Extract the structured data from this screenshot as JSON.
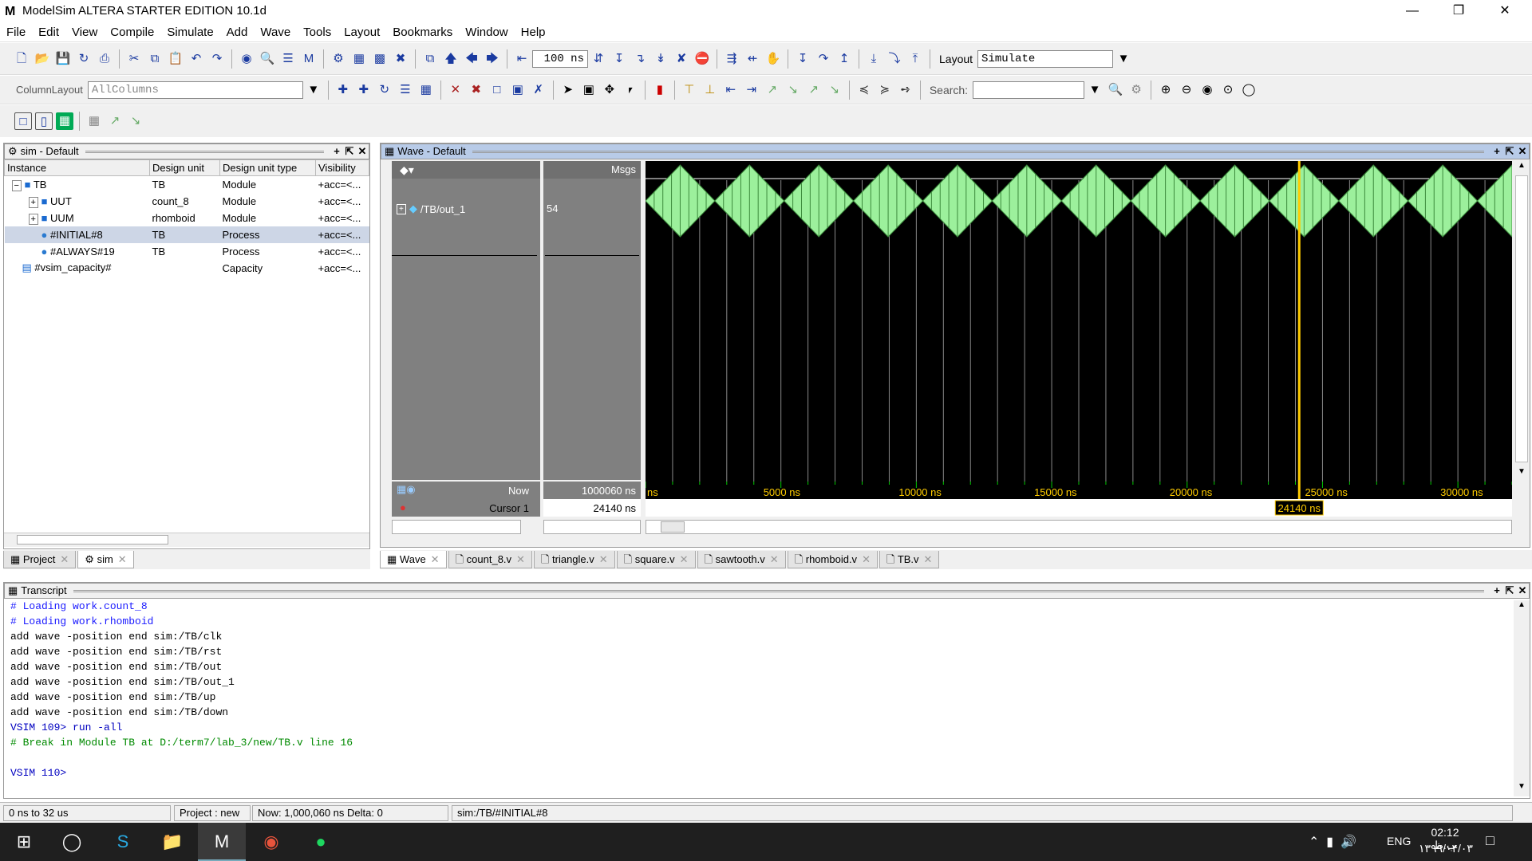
{
  "window": {
    "title": "ModelSim ALTERA STARTER EDITION 10.1d",
    "logo": "M"
  },
  "menu": [
    "File",
    "Edit",
    "View",
    "Compile",
    "Simulate",
    "Add",
    "Wave",
    "Tools",
    "Layout",
    "Bookmarks",
    "Window",
    "Help"
  ],
  "toolbar": {
    "run_length": "100 ns",
    "layout_label": "Layout",
    "layout_value": "Simulate",
    "column_layout_label": "ColumnLayout",
    "column_layout_value": "AllColumns",
    "search_label": "Search:"
  },
  "sim_panel": {
    "title": "sim - Default",
    "columns": [
      "Instance",
      "Design unit",
      "Design unit type",
      "Visibility"
    ],
    "rows": [
      {
        "instance": "TB",
        "unit": "TB",
        "type": "Module",
        "vis": "+acc=<..."
      },
      {
        "instance": "UUT",
        "unit": "count_8",
        "type": "Module",
        "vis": "+acc=<..."
      },
      {
        "instance": "UUM",
        "unit": "rhomboid",
        "type": "Module",
        "vis": "+acc=<..."
      },
      {
        "instance": "#INITIAL#8",
        "unit": "TB",
        "type": "Process",
        "vis": "+acc=<..."
      },
      {
        "instance": "#ALWAYS#19",
        "unit": "TB",
        "type": "Process",
        "vis": "+acc=<..."
      },
      {
        "instance": "#vsim_capacity#",
        "unit": "",
        "type": "Capacity",
        "vis": "+acc=<..."
      }
    ],
    "tabs": [
      "Project",
      "sim"
    ]
  },
  "wave_panel": {
    "title": "Wave - Default",
    "msgs_label": "Msgs",
    "signal": "/TB/out_1",
    "signal_value": "54",
    "now_label": "Now",
    "now_value": "1000060 ns",
    "cursor_label": "Cursor 1",
    "cursor_value": "24140 ns",
    "cursor_badge": "24140 ns",
    "cursor_time_ns": 24140,
    "view_start_ns": 0,
    "view_end_ns": 32000,
    "period_ns": 5120,
    "ticks": [
      "ns",
      "5000 ns",
      "10000 ns",
      "15000 ns",
      "20000 ns",
      "25000 ns",
      "30000 ns"
    ],
    "colors": {
      "wave": "#9cf09c",
      "cursor": "#ffcc00",
      "bg": "#000000"
    }
  },
  "doc_tabs": [
    "Wave",
    "count_8.v",
    "triangle.v",
    "square.v",
    "sawtooth.v",
    "rhomboid.v",
    "TB.v"
  ],
  "transcript": {
    "title": "Transcript",
    "lines": [
      {
        "t": "# Loading work.count_8",
        "c": "cmt"
      },
      {
        "t": "# Loading work.rhomboid",
        "c": "cmt"
      },
      {
        "t": "add wave -position end  sim:/TB/clk",
        "c": "cmd"
      },
      {
        "t": "add wave -position end  sim:/TB/rst",
        "c": "cmd"
      },
      {
        "t": "add wave -position end  sim:/TB/out",
        "c": "cmd"
      },
      {
        "t": "add wave -position end  sim:/TB/out_1",
        "c": "cmd"
      },
      {
        "t": "add wave -position end  sim:/TB/up",
        "c": "cmd"
      },
      {
        "t": "add wave -position end  sim:/TB/down",
        "c": "cmd"
      },
      {
        "t": "VSIM 109> run -all",
        "c": "prompt"
      },
      {
        "t": "# Break in Module TB at D:/term7/lab_3/new/TB.v line 16",
        "c": "brk"
      },
      {
        "t": "",
        "c": "cmd"
      },
      {
        "t": "VSIM 110>",
        "c": "prompt"
      }
    ]
  },
  "status": {
    "range": "0 ns to 32 us",
    "project": "Project : new",
    "now": "Now: 1,000,060 ns  Delta: 0",
    "path": "sim:/TB/#INITIAL#8"
  },
  "taskbar": {
    "lang": "ENG",
    "time": "02:12 ب.ظ",
    "date": "۱۳۹۹/۰۴/۰۳"
  }
}
